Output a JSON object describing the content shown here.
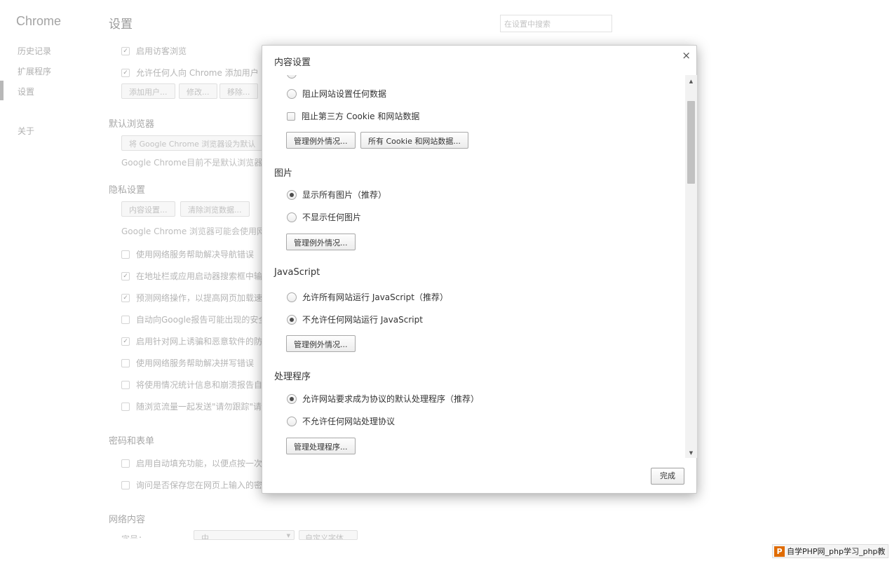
{
  "background": {
    "brand": "Chrome",
    "nav": [
      "历史记录",
      "扩展程序",
      "设置",
      "关于"
    ],
    "page_title": "设置",
    "search_placeholder": "在设置中搜索",
    "users": {
      "guest": "启用访客浏览",
      "allow_add": "允许任何人向 Chrome 添加用户",
      "buttons": [
        "添加用户...",
        "修改...",
        "移除..."
      ]
    },
    "default_browser": {
      "title": "默认浏览器",
      "button": "将 Google Chrome 浏览器设为默认",
      "note": "Google Chrome目前不是默认浏览器。"
    },
    "privacy": {
      "title": "隐私设置",
      "buttons": [
        "内容设置...",
        "清除浏览数据..."
      ],
      "note": "Google Chrome 浏览器可能会使用网络",
      "items": [
        {
          "label": "使用网络服务帮助解决导航错误",
          "checked": false
        },
        {
          "label": "在地址栏或应用启动器搜索框中输",
          "checked": true
        },
        {
          "label": "预测网络操作，以提高网页加载速",
          "checked": true
        },
        {
          "label": "自动向Google报告可能出现的安全",
          "checked": false
        },
        {
          "label": "启用针对网上诱骗和恶意软件的防",
          "checked": true
        },
        {
          "label": "使用网络服务帮助解决拼写错误",
          "checked": false
        },
        {
          "label": "将使用情况统计信息和崩溃报告自",
          "checked": false
        },
        {
          "label": "随浏览流量一起发送\"请勿跟踪\"请",
          "checked": false
        }
      ]
    },
    "passwords": {
      "title": "密码和表单",
      "items": [
        "启用自动填充功能，以便点按一次",
        "询问是否保存您在网页上输入的密"
      ]
    },
    "web_content": {
      "title": "网络内容",
      "font_label": "字号：",
      "font_value": "中",
      "font_button": "自定义字体..."
    }
  },
  "dialog": {
    "title": "内容设置",
    "close_glyph": "×",
    "cookies": {
      "block_all": "阻止网站设置任何数据",
      "block_third_party": "阻止第三方 Cookie 和网站数据",
      "exceptions_button": "管理例外情况...",
      "all_cookies_button": "所有 Cookie 和网站数据..."
    },
    "images": {
      "title": "图片",
      "options": [
        {
          "label": "显示所有图片（推荐）",
          "selected": true
        },
        {
          "label": "不显示任何图片",
          "selected": false
        }
      ],
      "exceptions_button": "管理例外情况..."
    },
    "javascript": {
      "title": "JavaScript",
      "options": [
        {
          "label": "允许所有网站运行 JavaScript（推荐）",
          "selected": false
        },
        {
          "label": "不允许任何网站运行 JavaScript",
          "selected": true
        }
      ],
      "exceptions_button": "管理例外情况..."
    },
    "handlers": {
      "title": "处理程序",
      "options": [
        {
          "label": "允许网站要求成为协议的默认处理程序（推荐）",
          "selected": true
        },
        {
          "label": "不允许任何网站处理协议",
          "selected": false
        }
      ],
      "manage_button": "管理处理程序..."
    },
    "done_button": "完成"
  },
  "watermark": {
    "logo": "P",
    "text": "自学PHP网_php学习_php教"
  }
}
